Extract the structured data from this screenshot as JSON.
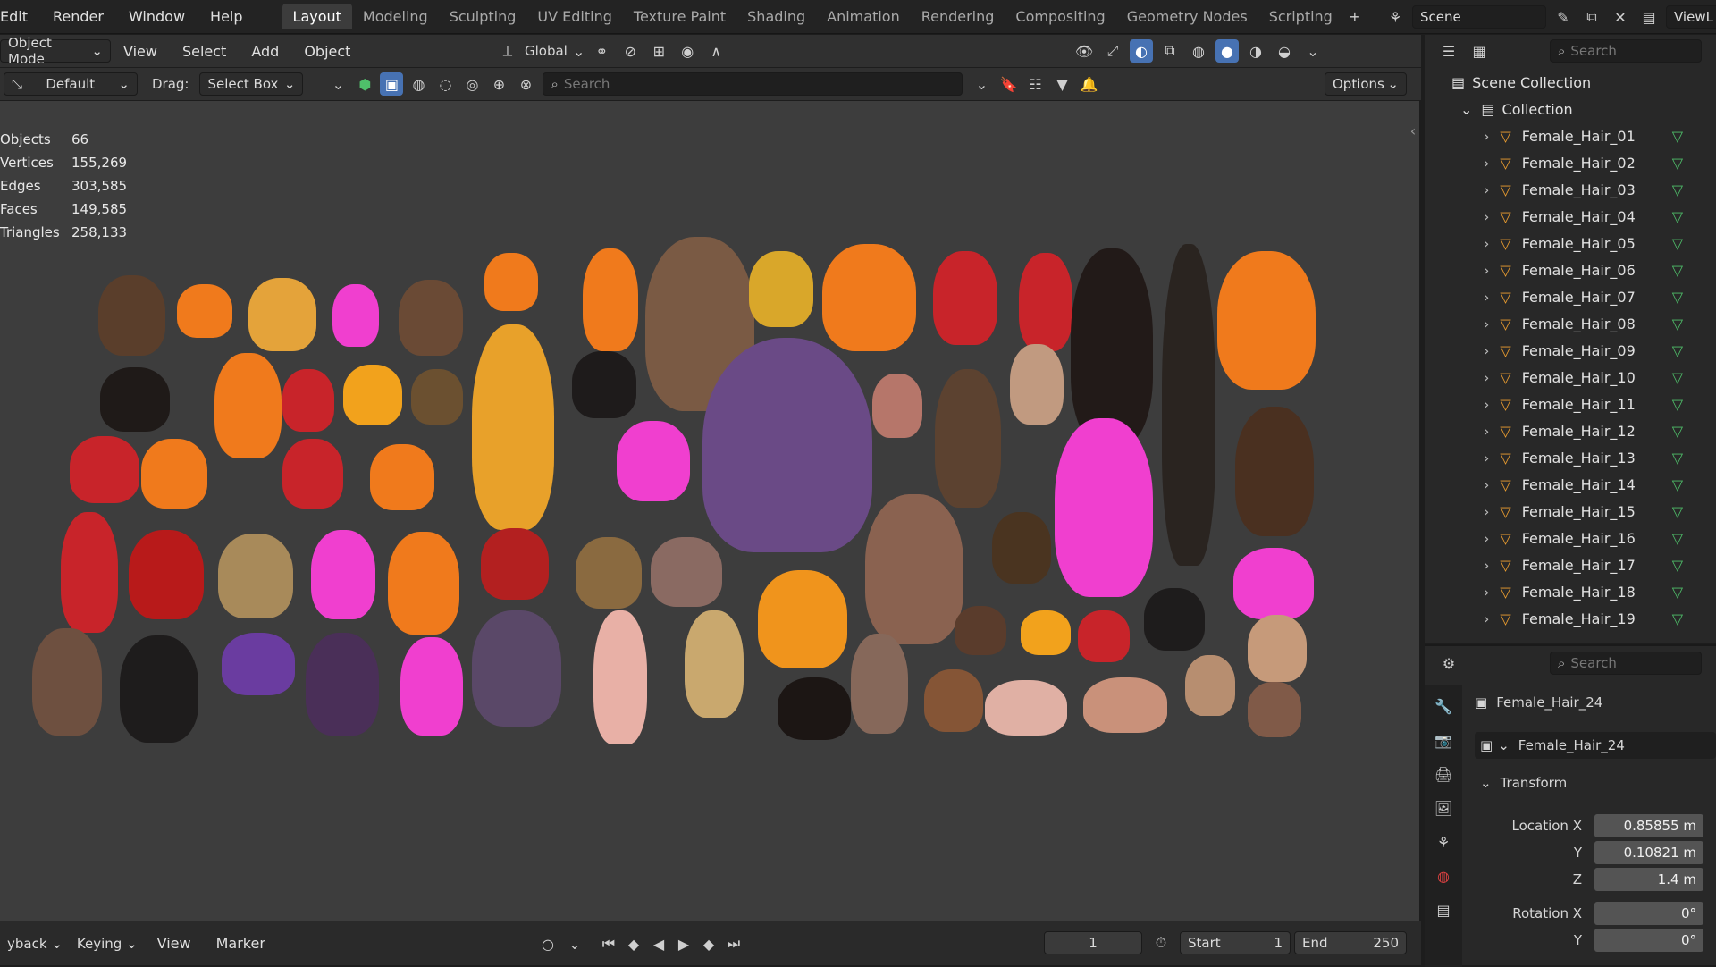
{
  "topbar": {
    "menus": [
      "Edit",
      "Render",
      "Window",
      "Help"
    ],
    "workspaces": [
      "Layout",
      "Modeling",
      "Sculpting",
      "UV Editing",
      "Texture Paint",
      "Shading",
      "Animation",
      "Rendering",
      "Compositing",
      "Geometry Nodes",
      "Scripting"
    ],
    "active_workspace": "Layout",
    "scene_label": "Scene",
    "view_layer_label": "ViewL"
  },
  "header2": {
    "mode": "Object Mode",
    "menus": [
      "View",
      "Select",
      "Add",
      "Object"
    ],
    "orientation": "Global"
  },
  "header3": {
    "preset": "Default",
    "drag_label": "Drag:",
    "drag_value": "Select Box",
    "search_placeholder": "Search",
    "options_label": "Options"
  },
  "stats": [
    {
      "label": "Objects",
      "value": "66"
    },
    {
      "label": "Vertices",
      "value": "155,269"
    },
    {
      "label": "Edges",
      "value": "303,585"
    },
    {
      "label": "Faces",
      "value": "149,585"
    },
    {
      "label": "Triangles",
      "value": "258,133"
    }
  ],
  "outliner": {
    "search_placeholder": "Search",
    "scene_collection": "Scene Collection",
    "collection": "Collection",
    "items": [
      "Female_Hair_01",
      "Female_Hair_02",
      "Female_Hair_03",
      "Female_Hair_04",
      "Female_Hair_05",
      "Female_Hair_06",
      "Female_Hair_07",
      "Female_Hair_08",
      "Female_Hair_09",
      "Female_Hair_10",
      "Female_Hair_11",
      "Female_Hair_12",
      "Female_Hair_13",
      "Female_Hair_14",
      "Female_Hair_15",
      "Female_Hair_16",
      "Female_Hair_17",
      "Female_Hair_18",
      "Female_Hair_19"
    ]
  },
  "properties": {
    "search_placeholder": "Search",
    "object_name": "Female_Hair_24",
    "data_name": "Female_Hair_24",
    "panel_title": "Transform",
    "location_x_label": "Location X",
    "location_x": "0.85855 m",
    "location_y_label": "Y",
    "location_y": "0.10821 m",
    "location_z_label": "Z",
    "location_z": "1.4 m",
    "rotation_x_label": "Rotation X",
    "rotation_x": "0°",
    "rotation_y_label": "Y",
    "rotation_y": "0°"
  },
  "timeline": {
    "playback": "yback",
    "keying": "Keying",
    "view": "View",
    "marker": "Marker",
    "current_frame": "1",
    "start_label": "Start",
    "start_value": "1",
    "end_label": "End",
    "end_value": "250"
  },
  "colors": {
    "orange": "#f07a1c",
    "pink": "#f03fcf",
    "red": "#c8242a",
    "brown": "#6a4a35",
    "blonde": "#e4a33a",
    "purple": "#6a4a86"
  }
}
